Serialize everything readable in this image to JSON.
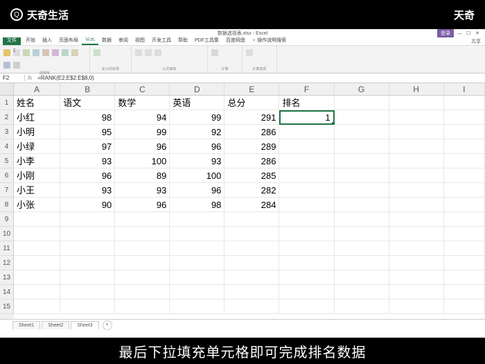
{
  "watermark": {
    "logo_text": "天奇生活",
    "right_text": "天奇"
  },
  "window": {
    "title": "数据透视表.xlsx - Excel",
    "login": "登录"
  },
  "tabs": {
    "file": "文件",
    "items": [
      "开始",
      "插入",
      "页面布局",
      "公式",
      "数据",
      "审阅",
      "视图",
      "开发工具",
      "帮助",
      "PDF工具集",
      "百度网盘"
    ],
    "active_index": 3,
    "extra": "操作说明搜索",
    "right": [
      "共享"
    ]
  },
  "ribbon_groups": [
    "函数库",
    "定义的名称",
    "公式审核",
    "计算",
    "计算选项"
  ],
  "formula_bar": {
    "cell_ref": "F2",
    "fx": "fx",
    "formula": "=RANK(E2,E$2:E$8,0)"
  },
  "columns": [
    "A",
    "B",
    "C",
    "D",
    "E",
    "F",
    "G",
    "H",
    "I"
  ],
  "headers": [
    "姓名",
    "语文",
    "数学",
    "英语",
    "总分",
    "排名"
  ],
  "rows": [
    {
      "name": "小红",
      "chinese": 98,
      "math": 94,
      "english": 99,
      "total": 291,
      "rank": 1
    },
    {
      "name": "小明",
      "chinese": 95,
      "math": 99,
      "english": 92,
      "total": 286,
      "rank": ""
    },
    {
      "name": "小绿",
      "chinese": 97,
      "math": 96,
      "english": 96,
      "total": 289,
      "rank": ""
    },
    {
      "name": "小李",
      "chinese": 93,
      "math": 100,
      "english": 93,
      "total": 286,
      "rank": ""
    },
    {
      "name": "小刚",
      "chinese": 96,
      "math": 89,
      "english": 100,
      "total": 285,
      "rank": ""
    },
    {
      "name": "小王",
      "chinese": 93,
      "math": 93,
      "english": 96,
      "total": 282,
      "rank": ""
    },
    {
      "name": "小张",
      "chinese": 90,
      "math": 96,
      "english": 98,
      "total": 284,
      "rank": ""
    }
  ],
  "row_numbers": [
    1,
    2,
    3,
    4,
    5,
    6,
    7,
    8,
    9,
    10,
    11,
    12,
    13,
    14,
    15
  ],
  "sheet_tabs": [
    "Sheet1",
    "Sheet2",
    "Sheet3"
  ],
  "active_sheet": 2,
  "caption": "最后下拉填充单元格即可完成排名数据"
}
